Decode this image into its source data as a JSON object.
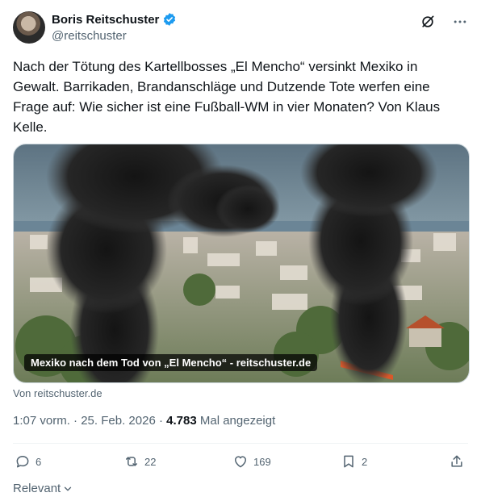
{
  "author": {
    "name": "Boris Reitschuster",
    "handle": "@reitschuster"
  },
  "icons": {
    "verified": "verified-badge-icon",
    "grok": "grok-icon",
    "more": "more-icon"
  },
  "tweet": {
    "text": "Nach der Tötung des Kartellbosses „El Mencho“ versinkt Mexiko in Gewalt. Barrikaden, Brandanschläge und Dutzende Tote werfen eine Frage auf: Wie sicher ist eine Fußball-WM in vier Monaten? Von Klaus Kelle."
  },
  "media": {
    "caption": "Mexiko nach dem Tod von „El Mencho“ - reitschuster.de"
  },
  "source": "Von reitschuster.de",
  "meta": {
    "time": "1:07 vorm.",
    "separator": "·",
    "date": "25. Feb. 2026",
    "views": "4.783",
    "views_label": "Mal angezeigt"
  },
  "actions": {
    "replies": "6",
    "reposts": "22",
    "likes": "169",
    "bookmarks": "2"
  },
  "sort": {
    "label": "Relevant"
  },
  "colors": {
    "accent": "#1d9bf0",
    "secondary_text": "#536471"
  }
}
